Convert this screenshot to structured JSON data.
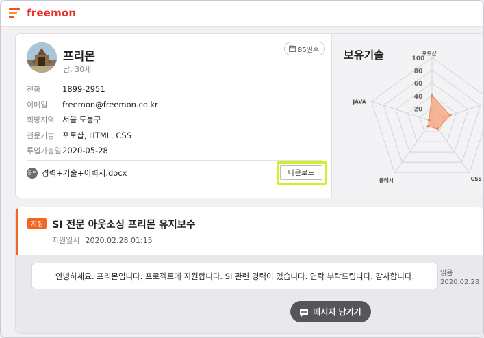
{
  "brand": {
    "name": "freemon"
  },
  "profile": {
    "name": "프리몬",
    "sub": "남, 30세",
    "availability_badge": "85일후",
    "fields": [
      {
        "label": "전화",
        "value": "1899-2951"
      },
      {
        "label": "이메일",
        "value": "freemon@freemon.co.kr"
      },
      {
        "label": "희망지역",
        "value": "서울 도봉구"
      },
      {
        "label": "전문기술",
        "value": "포토샵, HTML, CSS"
      },
      {
        "label": "투입가능일",
        "value": "2020-05-28"
      }
    ],
    "file_icon_label": "문드",
    "file_name": "경력+기술+이력서.docx",
    "download_label": "다운로드"
  },
  "skills": {
    "title": "보유기술",
    "chart_data": {
      "type": "radar",
      "axes": [
        "포토샵",
        "",
        "CSS",
        "플래시",
        "JAVA"
      ],
      "ticks": [
        20,
        40,
        60,
        80,
        100
      ],
      "ylim": [
        0,
        100
      ],
      "values": [
        40,
        30,
        15,
        10,
        5
      ]
    }
  },
  "application": {
    "tag": "지원",
    "title": "SI 전문 아웃소싱 프리몬 유지보수",
    "time_label": "지원일시",
    "time_value": "2020.02.28 01:15",
    "message": "안녕하세요. 프리몬입니다. 프로젝트에 지원합니다. SI 관련 경력이 있습니다. 연락 부탁드립니다. 감사합니다.",
    "read_label": "읽음",
    "read_date": "2020.02.28",
    "message_button": "메시지 남기기"
  },
  "colors": {
    "accent": "#f26522",
    "brand": "#e8322b",
    "highlight": "#ccf227",
    "radar_fill": "#f6a07a"
  }
}
